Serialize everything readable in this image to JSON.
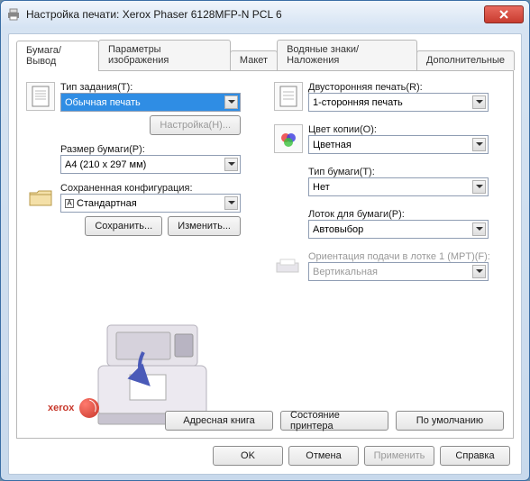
{
  "window": {
    "title": "Настройка печати: Xerox Phaser 6128MFP-N PCL 6"
  },
  "tabs": [
    "Бумага/Вывод",
    "Параметры изображения",
    "Макет",
    "Водяные знаки/Наложения",
    "Дополнительные"
  ],
  "left": {
    "job_type_label": "Тип задания(Т):",
    "job_type_value": "Обычная печать",
    "setup_btn": "Настройка(Н)...",
    "paper_size_label": "Размер бумаги(Р):",
    "paper_size_value": "A4 (210 x 297 мм)",
    "saved_label": "Сохраненная конфигурация:",
    "saved_value_prefix": "A",
    "saved_value": "Стандартная",
    "save_btn": "Сохранить...",
    "edit_btn": "Изменить..."
  },
  "right": {
    "duplex_label": "Двусторонняя печать(R):",
    "duplex_value": "1-сторонняя печать",
    "color_label": "Цвет копии(О):",
    "color_value": "Цветная",
    "paper_type_label": "Тип бумаги(Т):",
    "paper_type_value": "Нет",
    "tray_label": "Лоток для бумаги(Р):",
    "tray_value": "Автовыбор",
    "orient_label": "Ориентация подачи в лотке 1 (MPT)(F):",
    "orient_value": "Вертикальная"
  },
  "bottom": {
    "address_book": "Адресная книга",
    "printer_status": "Состояние принтера",
    "defaults": "По умолчанию"
  },
  "footer": {
    "ok": "OK",
    "cancel": "Отмена",
    "apply": "Применить",
    "help": "Справка"
  },
  "logo": "xerox"
}
